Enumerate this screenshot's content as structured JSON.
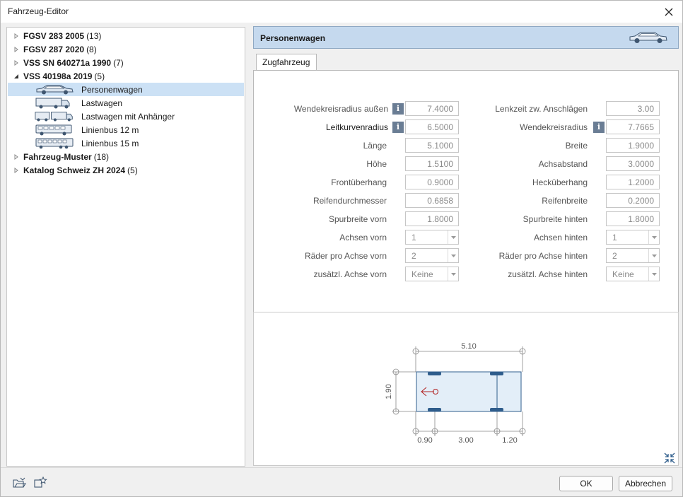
{
  "window": {
    "title": "Fahrzeug-Editor"
  },
  "tree": {
    "items": [
      {
        "label": "FGSV 283 2005",
        "count": "(13)"
      },
      {
        "label": "FGSV 287 2020",
        "count": "(8)"
      },
      {
        "label": "VSS SN 640271a 1990",
        "count": "(7)"
      },
      {
        "label": "VSS 40198a 2019",
        "count": "(5)"
      },
      {
        "label": "Personenwagen"
      },
      {
        "label": "Lastwagen"
      },
      {
        "label": "Lastwagen mit Anhänger"
      },
      {
        "label": "Linienbus 12 m"
      },
      {
        "label": "Linienbus 15 m"
      },
      {
        "label": "Fahrzeug-Muster",
        "count": "(18)"
      },
      {
        "label": "Katalog Schweiz ZH 2024",
        "count": "(5)"
      }
    ]
  },
  "header": {
    "vehicle_name": "Personenwagen"
  },
  "tabs": [
    {
      "label": "Zugfahrzeug"
    }
  ],
  "left_fields": [
    {
      "label": "Wendekreisradius außen",
      "value": "7.4000"
    },
    {
      "label": "Leitkurvenradius",
      "value": "6.5000"
    },
    {
      "label": "Länge",
      "value": "5.1000"
    },
    {
      "label": "Höhe",
      "value": "1.5100"
    },
    {
      "label": "Frontüberhang",
      "value": "0.9000"
    },
    {
      "label": "Reifendurchmesser",
      "value": "0.6858"
    },
    {
      "label": "Spurbreite vorn",
      "value": "1.8000"
    },
    {
      "label": "Achsen vorn",
      "value": "1"
    },
    {
      "label": "Räder pro Achse vorn",
      "value": "2"
    },
    {
      "label": "zusätzl. Achse vorn",
      "value": "Keine"
    }
  ],
  "right_fields": [
    {
      "label": "Lenkzeit zw. Anschlägen",
      "value": "3.00"
    },
    {
      "label": "Wendekreisradius",
      "value": "7.7665"
    },
    {
      "label": "Breite",
      "value": "1.9000"
    },
    {
      "label": "Achsabstand",
      "value": "3.0000"
    },
    {
      "label": "Hecküberhang",
      "value": "1.2000"
    },
    {
      "label": "Reifenbreite",
      "value": "0.2000"
    },
    {
      "label": "Spurbreite hinten",
      "value": "1.8000"
    },
    {
      "label": "Achsen hinten",
      "value": "1"
    },
    {
      "label": "Räder pro Achse hinten",
      "value": "2"
    },
    {
      "label": "zusätzl. Achse hinten",
      "value": "Keine"
    }
  ],
  "preview": {
    "length_label": "5.10",
    "width_label": "1.90",
    "front_overhang_label": "0.90",
    "wheelbase_label": "3.00",
    "rear_overhang_label": "1.20"
  },
  "footer": {
    "ok_label": "OK",
    "cancel_label": "Abbrechen"
  },
  "colors": {
    "accent": "#c5d9ee",
    "selection": "#cce1f5",
    "info": "#6a7d94",
    "axle": "#2f5d8c",
    "arrow": "#b22222"
  }
}
